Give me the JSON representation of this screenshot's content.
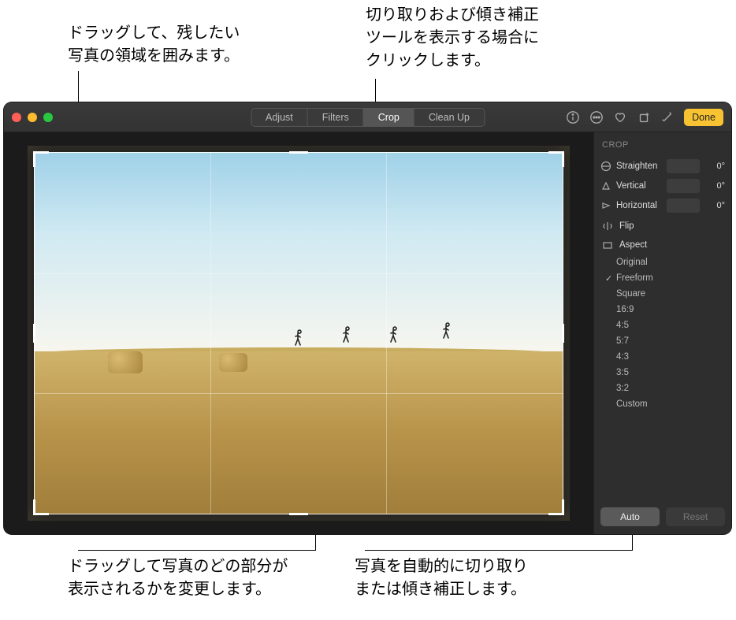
{
  "callouts": {
    "top_left": "ドラッグして、残したい\n写真の領域を囲みます。",
    "top_right": "切り取りおよび傾き補正\nツールを表示する場合に\nクリックします。",
    "bottom_left": "ドラッグして写真のどの部分が\n表示されるかを変更します。",
    "bottom_right": "写真を自動的に切り取り\nまたは傾き補正します。"
  },
  "tabs": {
    "adjust": "Adjust",
    "filters": "Filters",
    "crop": "Crop",
    "cleanup": "Clean Up"
  },
  "toolbar": {
    "done": "Done"
  },
  "panel": {
    "title": "CROP",
    "straighten": {
      "label": "Straighten",
      "value": "0°"
    },
    "vertical": {
      "label": "Vertical",
      "value": "0°"
    },
    "horizontal": {
      "label": "Horizontal",
      "value": "0°"
    },
    "flip": "Flip",
    "aspect": "Aspect",
    "aspects": {
      "original": "Original",
      "freeform": "Freeform",
      "square": "Square",
      "r169": "16:9",
      "r45": "4:5",
      "r57": "5:7",
      "r43": "4:3",
      "r35": "3:5",
      "r32": "3:2",
      "custom": "Custom"
    },
    "auto": "Auto",
    "reset": "Reset"
  }
}
